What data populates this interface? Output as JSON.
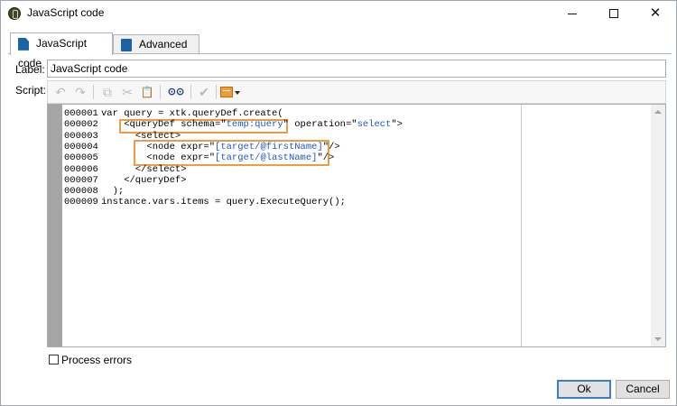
{
  "window": {
    "title": "JavaScript code",
    "controls": {
      "minimize": "",
      "maximize": "",
      "close": "✕"
    }
  },
  "tabs": [
    {
      "label": "JavaScript code",
      "icon": "script-icon",
      "active": true
    },
    {
      "label": "Advanced",
      "icon": "clipboard-icon",
      "active": false
    }
  ],
  "form": {
    "label_caption": "Label:",
    "label_value": "JavaScript code",
    "script_caption": "Script:"
  },
  "toolbar": {
    "undo": "↶",
    "redo": "↷",
    "copy": "⧉",
    "cut": "✂",
    "paste": "📋",
    "find": "⊙⊙",
    "check": "✔"
  },
  "editor": {
    "line_numbers": [
      "000001",
      "000002",
      "000003",
      "000004",
      "000005",
      "000006",
      "000007",
      "000008",
      "000009"
    ],
    "lines": [
      [
        {
          "t": "var query = xtk.queryDef.create("
        }
      ],
      [
        {
          "t": "    <queryDef schema=\""
        },
        {
          "t": "temp:query",
          "s": 1
        },
        {
          "t": "\" operation=\""
        },
        {
          "t": "select",
          "s": 1
        },
        {
          "t": "\">"
        }
      ],
      [
        {
          "t": "      <select>"
        }
      ],
      [
        {
          "t": "        <node expr=\""
        },
        {
          "t": "[target/@firstName]",
          "s": 1
        },
        {
          "t": "\"/>"
        }
      ],
      [
        {
          "t": "        <node expr=\""
        },
        {
          "t": "[target/@lastName]",
          "s": 1
        },
        {
          "t": "\"/>"
        }
      ],
      [
        {
          "t": "      </select>"
        }
      ],
      [
        {
          "t": "    </queryDef>"
        }
      ],
      [
        {
          "t": "  );"
        }
      ],
      [
        {
          "t": "instance.vars.items = query.ExecuteQuery();"
        }
      ]
    ]
  },
  "options": {
    "process_errors_label": "Process errors",
    "process_errors_checked": false
  },
  "buttons": {
    "ok_label": "Ok",
    "cancel_label": "Cancel"
  },
  "colors": {
    "highlight": "#ef9a45",
    "string": "#1e58c9",
    "gutter": "#a5a5a5",
    "accent": "#3d7cc9"
  }
}
